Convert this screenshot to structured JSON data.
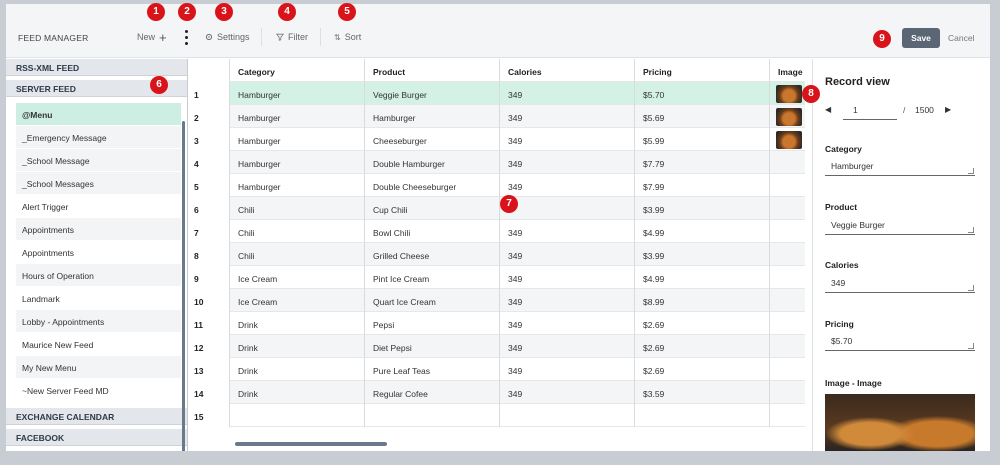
{
  "app_title": "FEED MANAGER",
  "toolbar": {
    "new_label": "New",
    "settings_label": "Settings",
    "filter_label": "Filter",
    "sort_label": "Sort",
    "save_label": "Save",
    "cancel_label": "Cancel"
  },
  "badges": [
    "1",
    "2",
    "3",
    "4",
    "5",
    "6",
    "7",
    "8",
    "9"
  ],
  "left": {
    "rss_header": "RSS-XML FEED",
    "server_header": "SERVER FEED",
    "items": [
      "@Menu",
      "_Emergency Message",
      "_School Message",
      "_School Messages",
      "Alert Trigger",
      "Appointments",
      "Appointments",
      "Hours of Operation",
      "Landmark",
      "Lobby - Appointments",
      "Maurice New Feed",
      "My New Menu",
      "~New Server Feed MD"
    ],
    "exchange_header": "EXCHANGE CALENDAR",
    "facebook_header": "FACEBOOK"
  },
  "grid": {
    "columns": [
      "Category",
      "Product",
      "Calories",
      "Pricing",
      "Image -"
    ],
    "rows": [
      {
        "num": "1",
        "category": "Hamburger",
        "product": "Veggie Burger",
        "calories": "349",
        "pricing": "$5.70"
      },
      {
        "num": "2",
        "category": "Hamburger",
        "product": "Hamburger",
        "calories": "349",
        "pricing": "$5.69"
      },
      {
        "num": "3",
        "category": "Hamburger",
        "product": "Cheeseburger",
        "calories": "349",
        "pricing": "$5.99"
      },
      {
        "num": "4",
        "category": "Hamburger",
        "product": "Double Hamburger",
        "calories": "349",
        "pricing": "$7.79"
      },
      {
        "num": "5",
        "category": "Hamburger",
        "product": "Double Cheeseburger",
        "calories": "349",
        "pricing": "$7.99"
      },
      {
        "num": "6",
        "category": "Chili",
        "product": "Cup Chili",
        "calories": "",
        "pricing": "$3.99"
      },
      {
        "num": "7",
        "category": "Chili",
        "product": "Bowl Chili",
        "calories": "349",
        "pricing": "$4.99"
      },
      {
        "num": "8",
        "category": "Chili",
        "product": "Grilled Cheese",
        "calories": "349",
        "pricing": "$3.99"
      },
      {
        "num": "9",
        "category": "Ice Cream",
        "product": "Pint Ice Cream",
        "calories": "349",
        "pricing": "$4.99"
      },
      {
        "num": "10",
        "category": "Ice Cream",
        "product": "Quart Ice Cream",
        "calories": "349",
        "pricing": "$8.99"
      },
      {
        "num": "11",
        "category": "Drink",
        "product": "Pepsi",
        "calories": "349",
        "pricing": "$2.69"
      },
      {
        "num": "12",
        "category": "Drink",
        "product": "Diet Pepsi",
        "calories": "349",
        "pricing": "$2.69"
      },
      {
        "num": "13",
        "category": "Drink",
        "product": "Pure Leaf Teas",
        "calories": "349",
        "pricing": "$2.69"
      },
      {
        "num": "14",
        "category": "Drink",
        "product": "Regular Cofee",
        "calories": "349",
        "pricing": "$3.59"
      },
      {
        "num": "15",
        "category": "",
        "product": "",
        "calories": "",
        "pricing": ""
      }
    ]
  },
  "record_view": {
    "title": "Record view",
    "current": "1",
    "separator": "/",
    "total": "1500",
    "fields": [
      {
        "label": "Category",
        "value": "Hamburger"
      },
      {
        "label": "Product",
        "value": "Veggie Burger"
      },
      {
        "label": "Calories",
        "value": "349"
      },
      {
        "label": "Pricing",
        "value": "$5.70"
      }
    ],
    "image_label": "Image - Image"
  },
  "colors": {
    "selected_row": "#d4f1e5",
    "badge": "#d8141a",
    "save_button": "#5b6674"
  }
}
